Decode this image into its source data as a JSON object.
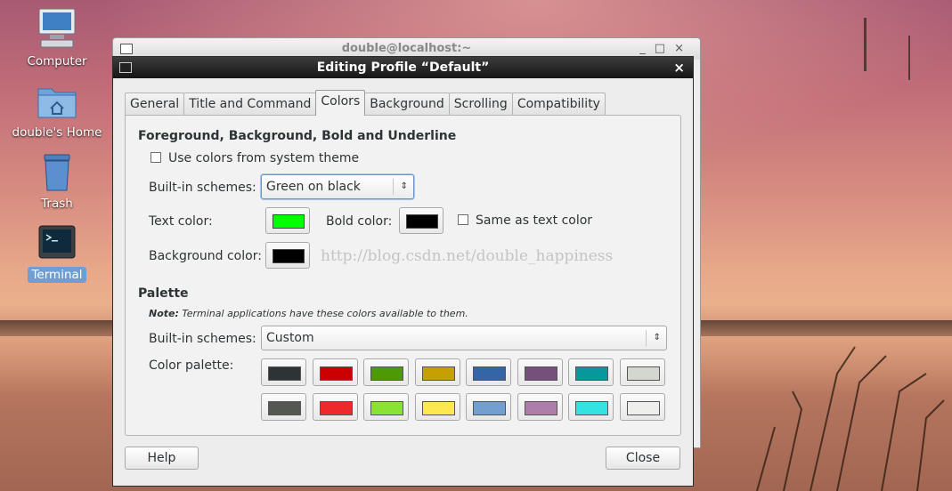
{
  "desktop": {
    "icons": [
      {
        "label": "Computer"
      },
      {
        "label": "double's Home"
      },
      {
        "label": "Trash"
      },
      {
        "label": "Terminal"
      }
    ]
  },
  "terminal_window": {
    "title": "double@localhost:~",
    "controls": [
      "_",
      "□",
      "×"
    ]
  },
  "dialog": {
    "title": "Editing Profile “Default”",
    "close_glyph": "×",
    "tabs": [
      "General",
      "Title and Command",
      "Colors",
      "Background",
      "Scrolling",
      "Compatibility"
    ],
    "active_tab": "Colors",
    "fg_section": {
      "heading": "Foreground, Background, Bold and Underline",
      "use_system_theme": {
        "label": "Use colors from system theme",
        "checked": false
      },
      "builtin_label": "Built-in schemes:",
      "builtin_value": "Green on black",
      "text_color_label": "Text color:",
      "text_color": "#00ff00",
      "bold_color_label": "Bold color:",
      "bold_color": "#000000",
      "same_as_text": {
        "label": "Same as text color",
        "checked": false
      },
      "bg_color_label": "Background color:",
      "bg_color": "#000000"
    },
    "watermark": "http://blog.csdn.net/double_happiness",
    "palette_section": {
      "heading": "Palette",
      "note_bold": "Note:",
      "note_text": " Terminal applications have these colors available to them.",
      "builtin_label": "Built-in schemes:",
      "builtin_value": "Custom",
      "palette_label": "Color palette:",
      "colors": [
        "#2e3436",
        "#cc0000",
        "#4e9a06",
        "#c4a000",
        "#3465a4",
        "#75507b",
        "#06989a",
        "#d3d7cf",
        "#555753",
        "#ef2929",
        "#8ae234",
        "#fce94f",
        "#729fcf",
        "#ad7fa8",
        "#34e2e2",
        "#eeeeec"
      ]
    },
    "help_label": "Help",
    "close_label": "Close"
  }
}
